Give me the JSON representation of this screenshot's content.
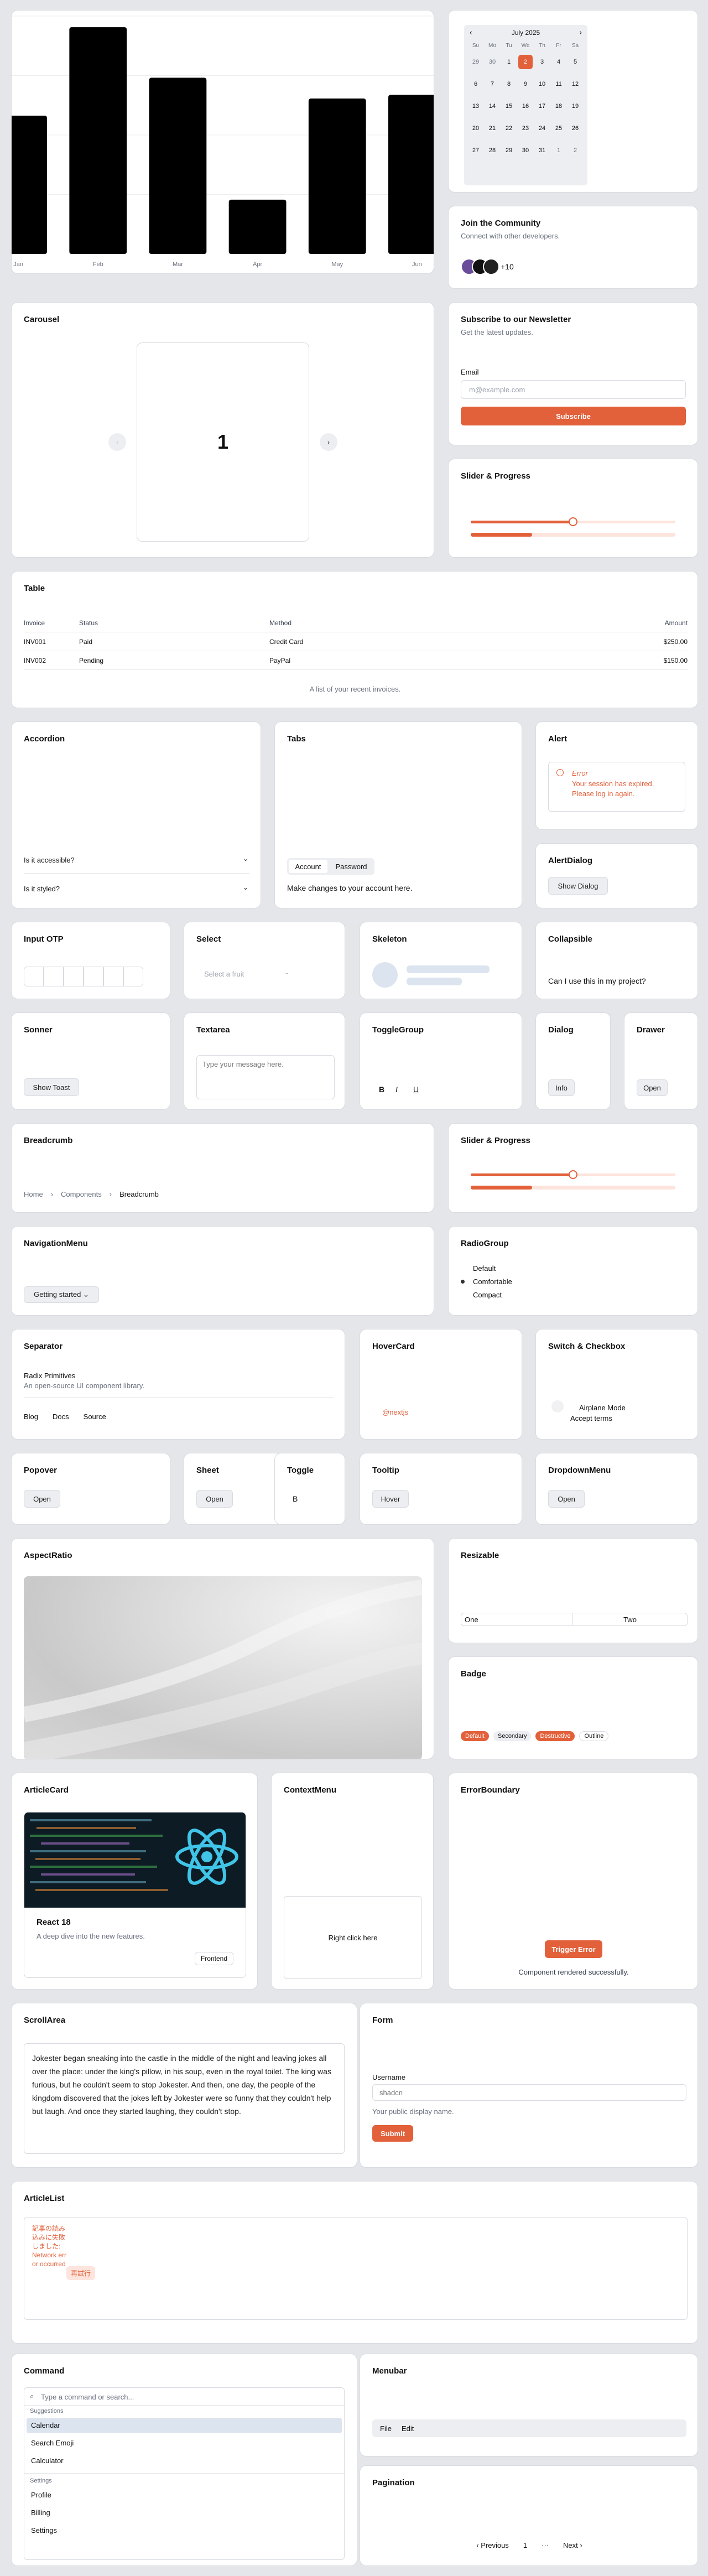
{
  "chart": {
    "chart_data": {
      "type": "bar",
      "categories": [
        "Jan",
        "Feb",
        "Mar",
        "Apr",
        "May",
        "Jun"
      ],
      "values": [
        186,
        305,
        237,
        73,
        209,
        214
      ],
      "ylim": [
        0,
        320
      ],
      "grid": true
    }
  },
  "calendar": {
    "month": "July 2025",
    "weekdays": [
      "Su",
      "Mo",
      "Tu",
      "We",
      "Th",
      "Fr",
      "Sa"
    ],
    "days": [
      [
        "29",
        "30",
        "1",
        "2",
        "3",
        "4",
        "5"
      ],
      [
        "6",
        "7",
        "8",
        "9",
        "10",
        "11",
        "12"
      ],
      [
        "13",
        "14",
        "15",
        "16",
        "17",
        "18",
        "19"
      ],
      [
        "20",
        "21",
        "22",
        "23",
        "24",
        "25",
        "26"
      ],
      [
        "27",
        "28",
        "29",
        "30",
        "31",
        "1",
        "2"
      ]
    ],
    "selected": "2",
    "prev": "‹",
    "next": "›"
  },
  "community": {
    "title": "Join the Community",
    "subtitle": "Connect with other developers.",
    "more": "+10"
  },
  "carousel": {
    "title": "Carousel",
    "slide": "1",
    "prev": "‹",
    "next": "›"
  },
  "newsletter": {
    "title": "Subscribe to our Newsletter",
    "subtitle": "Get the latest updates.",
    "email_label": "Email",
    "email_placeholder": "m@example.com",
    "button": "Subscribe"
  },
  "slider1": {
    "title": "Slider & Progress",
    "value": 0.5,
    "progress": 0.3
  },
  "table": {
    "title": "Table",
    "headers": [
      "Invoice",
      "Status",
      "Method",
      "Amount"
    ],
    "rows": [
      [
        "INV001",
        "Paid",
        "Credit Card",
        "$250.00"
      ],
      [
        "INV002",
        "Pending",
        "PayPal",
        "$150.00"
      ]
    ],
    "caption": "A list of your recent invoices."
  },
  "accordion": {
    "title": "Accordion",
    "items": [
      "Is it accessible?",
      "Is it styled?"
    ]
  },
  "tabs": {
    "title": "Tabs",
    "tabs": [
      "Account",
      "Password"
    ],
    "content": "Make changes to your account here."
  },
  "alert": {
    "title": "Alert",
    "heading": "Error",
    "message": "Your session has expired. Please log in again."
  },
  "alert_dialog": {
    "title": "AlertDialog",
    "button": "Show Dialog"
  },
  "otp": {
    "title": "Input OTP"
  },
  "select": {
    "title": "Select",
    "placeholder": "Select a fruit"
  },
  "skeleton": {
    "title": "Skeleton"
  },
  "collapsible": {
    "title": "Collapsible",
    "text": "Can I use this in my project?"
  },
  "sonner": {
    "title": "Sonner",
    "button": "Show Toast"
  },
  "textarea": {
    "title": "Textarea",
    "placeholder": "Type your message here."
  },
  "toggle_group": {
    "title": "ToggleGroup",
    "items": [
      "B",
      "I",
      "U"
    ]
  },
  "dialog": {
    "title": "Dialog",
    "button": "Info"
  },
  "drawer": {
    "title": "Drawer",
    "button": "Open"
  },
  "breadcrumb": {
    "title": "Breadcrumb",
    "items": [
      "Home",
      "Components",
      "Breadcrumb"
    ],
    "sep": "›"
  },
  "slider2": {
    "title": "Slider & Progress",
    "value": 0.5,
    "progress": 0.3
  },
  "nav_menu": {
    "title": "NavigationMenu",
    "button": "Getting started ⌄"
  },
  "radio": {
    "title": "RadioGroup",
    "options": [
      "Default",
      "Comfortable",
      "Compact"
    ],
    "selected": 1
  },
  "separator": {
    "title": "Separator",
    "heading": "Radix Primitives",
    "text": "An open-source UI component library.",
    "links": [
      "Blog",
      "Docs",
      "Source"
    ]
  },
  "hovercard": {
    "title": "HoverCard",
    "link": "@nextjs"
  },
  "switch": {
    "title": "Switch & Checkbox",
    "switch_label": "Airplane Mode",
    "checkbox_label": "Accept terms"
  },
  "popover": {
    "title": "Popover",
    "button": "Open"
  },
  "sheet": {
    "title": "Sheet",
    "button": "Open"
  },
  "toggle": {
    "title": "Toggle",
    "button": "B"
  },
  "tooltip": {
    "title": "Tooltip",
    "button": "Hover"
  },
  "dropdown": {
    "title": "DropdownMenu",
    "button": "Open"
  },
  "aspect": {
    "title": "AspectRatio"
  },
  "resizable": {
    "title": "Resizable",
    "left": "One",
    "right": "Two"
  },
  "badge": {
    "title": "Badge",
    "items": [
      "Default",
      "Secondary",
      "Destructive",
      "Outline"
    ]
  },
  "article_card": {
    "title": "ArticleCard",
    "heading": "React 18",
    "text": "A deep dive into the new features.",
    "tag": "Frontend"
  },
  "context_menu": {
    "title": "ContextMenu",
    "text": "Right click here"
  },
  "error_boundary": {
    "title": "ErrorBoundary",
    "button": "Trigger Error",
    "text": "Component rendered successfully."
  },
  "scroll_area": {
    "title": "ScrollArea",
    "text": "Jokester began sneaking into the castle in the middle of the night and leaving jokes all over the place: under the king's pillow, in his soup, even in the royal toilet. The king was furious, but he couldn't seem to stop Jokester. And then, one day, the people of the kingdom discovered that the jokes left by Jokester were so funny that they couldn't help but laugh. And once they started laughing, they couldn't stop."
  },
  "form": {
    "title": "Form",
    "label": "Username",
    "placeholder": "shadcn",
    "help": "Your public display name.",
    "button": "Submit"
  },
  "article_list": {
    "title": "ArticleList",
    "error": "記事の読み込みに失敗しました: Network error occurred",
    "retry": "再試行"
  },
  "command": {
    "title": "Command",
    "placeholder": "Type a command or search...",
    "groups": [
      {
        "name": "Suggestions",
        "items": [
          "Calendar",
          "Search Emoji",
          "Calculator"
        ]
      },
      {
        "name": "Settings",
        "items": [
          "Profile",
          "Billing",
          "Settings"
        ]
      }
    ]
  },
  "menubar": {
    "title": "Menubar",
    "items": [
      "File",
      "Edit"
    ]
  },
  "pagination": {
    "title": "Pagination",
    "prev": "‹ Previous",
    "page": "1",
    "ellipsis": "···",
    "next": "Next ›"
  },
  "colors": {
    "accent": "#e2603a",
    "bar": "#000000",
    "error": "#e2603a"
  }
}
